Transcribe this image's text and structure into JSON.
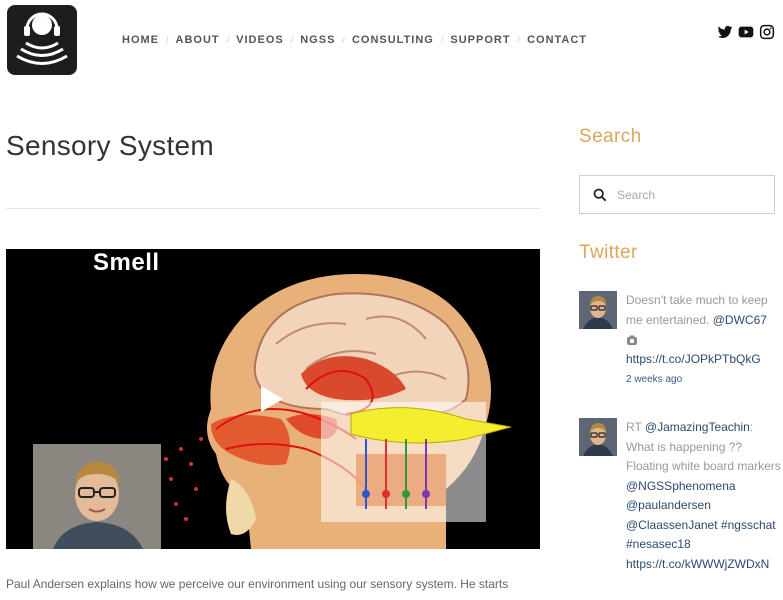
{
  "nav": {
    "items": [
      "Home",
      "About",
      "Videos",
      "NGSS",
      "Consulting",
      "Support",
      "Contact"
    ]
  },
  "social": {
    "icons": [
      "twitter-icon",
      "youtube-icon",
      "instagram-icon"
    ]
  },
  "post": {
    "title": "Sensory System",
    "video_label": "Smell",
    "excerpt": "Paul Andersen explains how we perceive our environment using our sensory system. He starts"
  },
  "sidebar": {
    "search_heading": "Search",
    "search_placeholder": "Search",
    "twitter_heading": "Twitter",
    "tweets": [
      {
        "text": "Doesn't take much to keep me entertained.",
        "mention": "@DWC67",
        "link": "https://t.co/JOPkPTbQkG",
        "time": "2 weeks ago"
      },
      {
        "prefix": "RT",
        "mention": "@JamazingTeachin",
        "text_colon": ":",
        "text": "What is happening ?? Floating white board markers",
        "mention2": "@NGSSphenomena",
        "mention3": "@paulandersen",
        "mention4": "@ClaassenJanet",
        "hashtag1": "#ngsschat",
        "hashtag2": "#nesasec18",
        "link": "https://t.co/kWWWjZWDxN"
      }
    ]
  },
  "colors": {
    "accent": "#d9a85a",
    "link": "#2b4a73"
  }
}
